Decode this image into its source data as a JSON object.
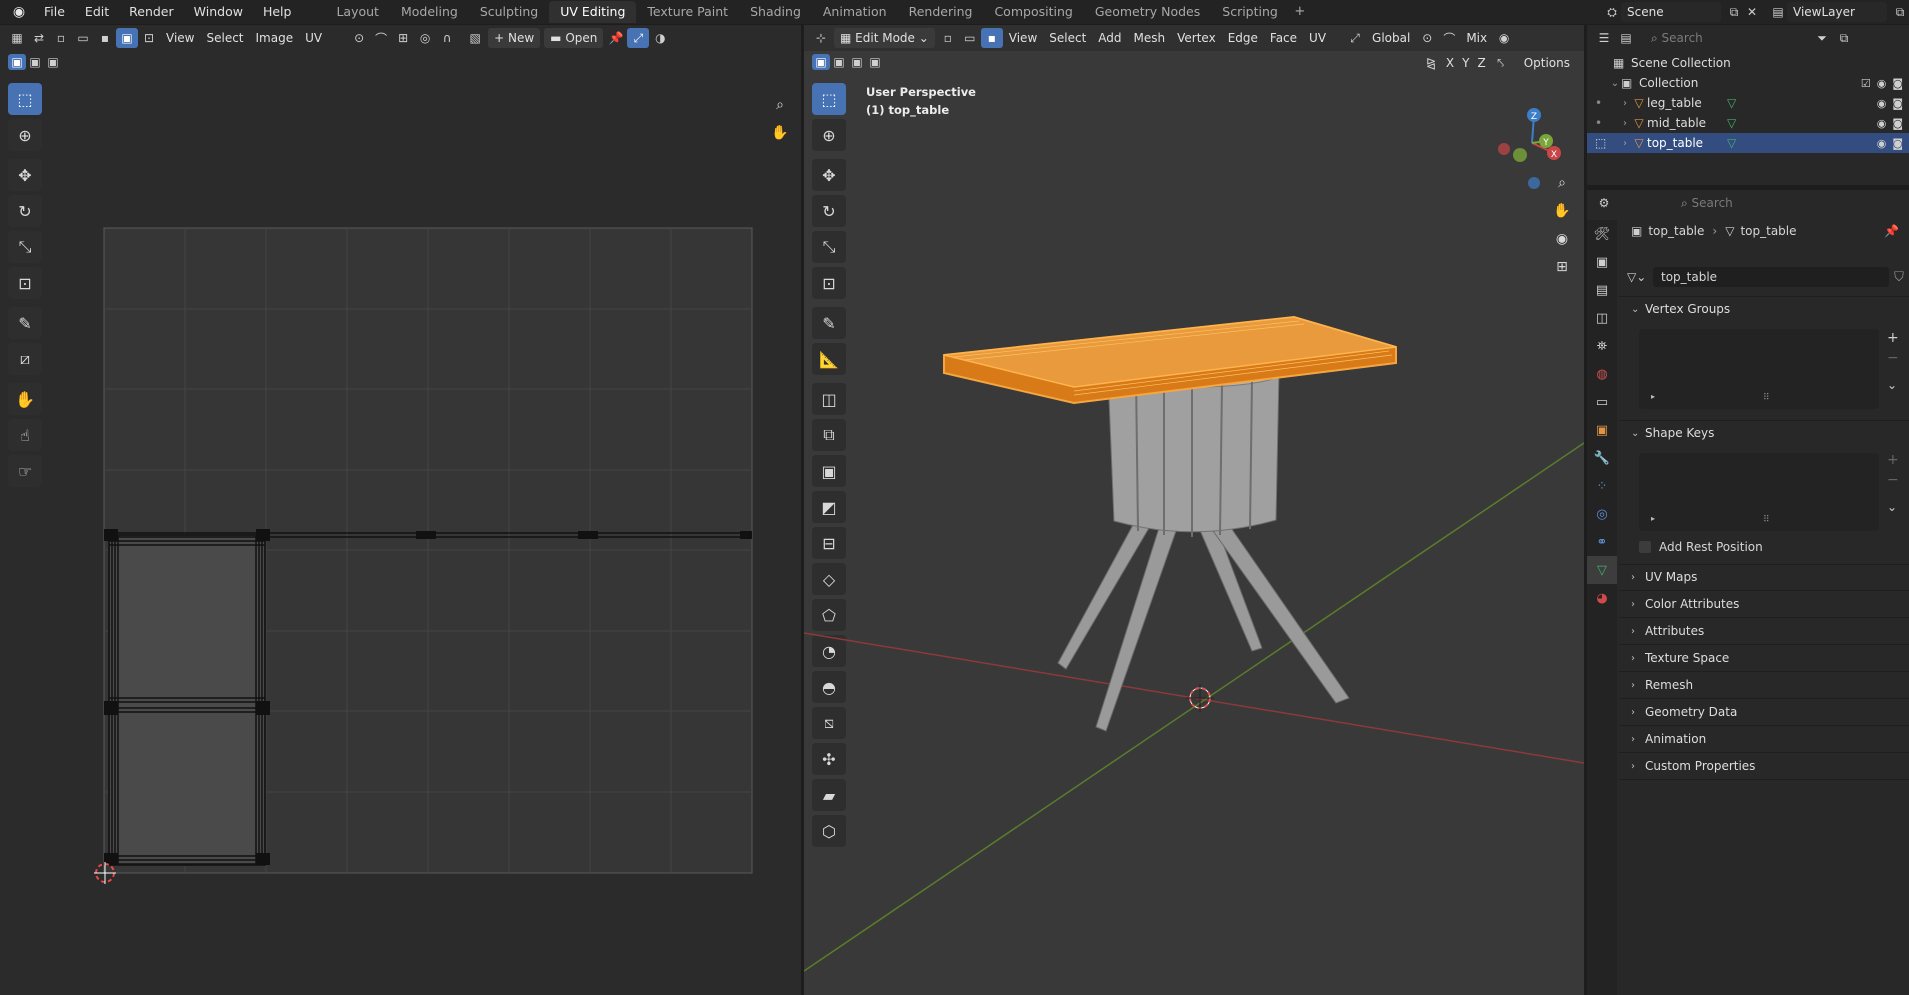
{
  "topbar": {
    "menus": [
      "File",
      "Edit",
      "Render",
      "Window",
      "Help"
    ],
    "workspaces": [
      "Layout",
      "Modeling",
      "Sculpting",
      "UV Editing",
      "Texture Paint",
      "Shading",
      "Animation",
      "Rendering",
      "Compositing",
      "Geometry Nodes",
      "Scripting"
    ],
    "active_workspace": "UV Editing",
    "add_workspace": "+",
    "scene": "Scene",
    "view_layer": "ViewLayer"
  },
  "uv_editor": {
    "menus": [
      "View",
      "Select",
      "Image",
      "UV"
    ],
    "new_label": "New",
    "open_label": "Open"
  },
  "viewport": {
    "mode": "Edit Mode",
    "menus": [
      "View",
      "Select",
      "Add",
      "Mesh",
      "Vertex",
      "Edge",
      "Face",
      "UV"
    ],
    "orientation": "Global",
    "shading": "Mix",
    "options_label": "Options",
    "axes": [
      "X",
      "Y",
      "Z"
    ],
    "perspective_label": "User Perspective",
    "object_label": "(1) top_table",
    "gizmo_axes": {
      "x": "X",
      "y": "Y",
      "z": "Z"
    },
    "colors": {
      "selection": "#f0901e",
      "x_axis": "#c84646",
      "y_axis": "#7aa53a"
    }
  },
  "outliner": {
    "search_placeholder": "Search",
    "root": "Scene Collection",
    "collection": "Collection",
    "objects": [
      "leg_table",
      "mid_table",
      "top_table"
    ],
    "selected": "top_table"
  },
  "properties": {
    "search_placeholder": "Search",
    "breadcrumb_object": "top_table",
    "breadcrumb_data": "top_table",
    "mesh_name": "top_table",
    "panels_open": [
      "Vertex Groups",
      "Shape Keys"
    ],
    "add_rest_position": "Add Rest Position",
    "panels_closed": [
      "UV Maps",
      "Color Attributes",
      "Attributes",
      "Texture Space",
      "Remesh",
      "Geometry Data",
      "Animation",
      "Custom Properties"
    ]
  }
}
